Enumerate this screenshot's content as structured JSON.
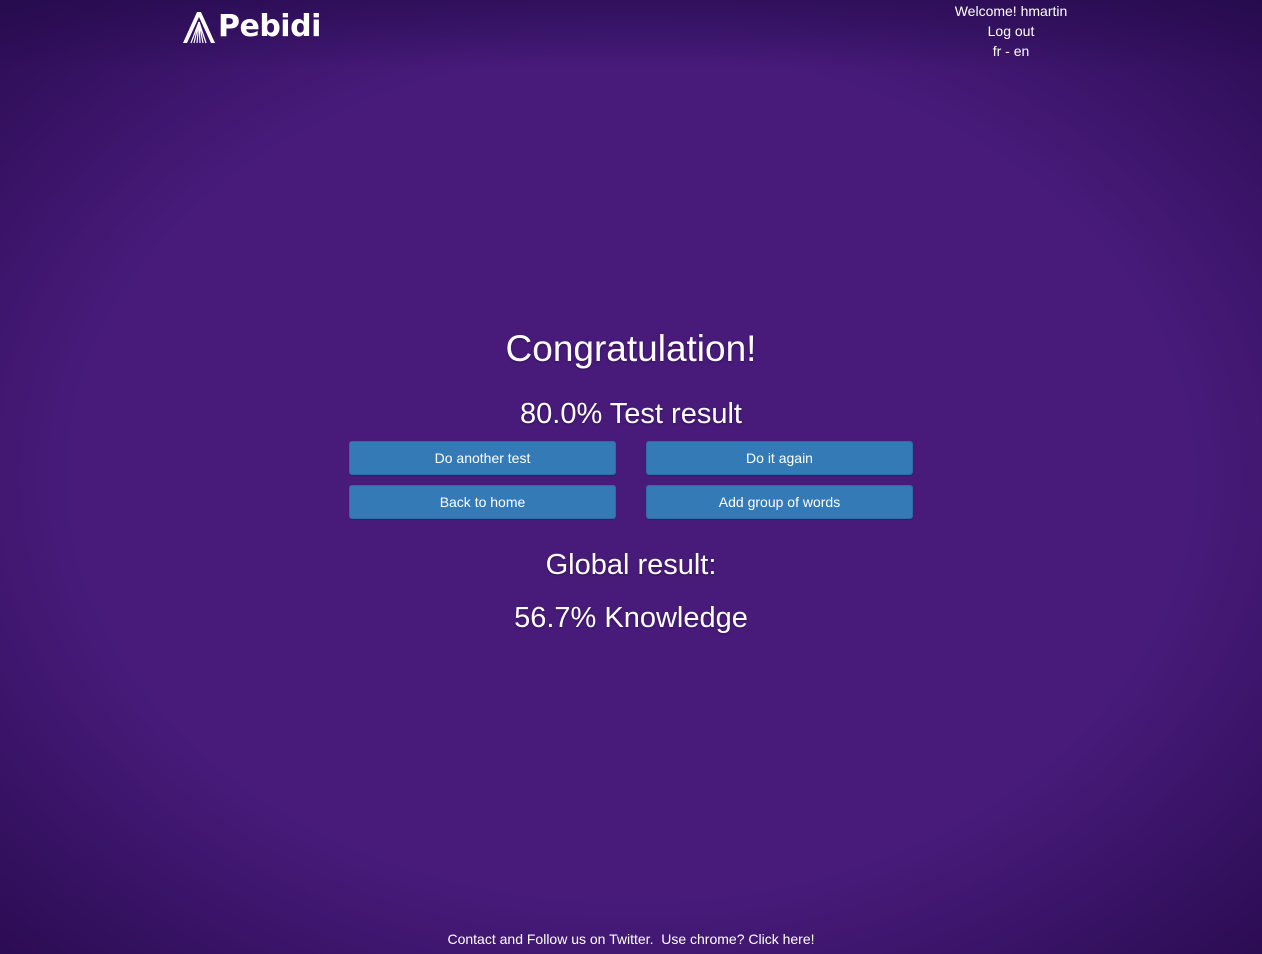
{
  "header": {
    "logo_text": "Pebidi",
    "logo_icon": "pebidi-logo-icon",
    "welcome": "Welcome! hmartin",
    "logout": "Log out",
    "lang_fr": "fr",
    "lang_separator": " - ",
    "lang_en": "en"
  },
  "result": {
    "congrats": "Congratulation!",
    "test_result": "80.0% Test result",
    "global_label": "Global result:",
    "knowledge": "56.7% Knowledge"
  },
  "buttons": {
    "another_test": "Do another test",
    "again": "Do it again",
    "home": "Back to home",
    "add_group": "Add group of words"
  },
  "footer": {
    "contact": "Contact",
    "and_text": " and ",
    "follow": "Follow us on Twitter",
    "period": ".  ",
    "chrome": "Use chrome? Click here!"
  },
  "colors": {
    "background": "#481b7b",
    "button": "#337ab7",
    "button_border": "#2e6da4",
    "text": "#ffffff"
  }
}
